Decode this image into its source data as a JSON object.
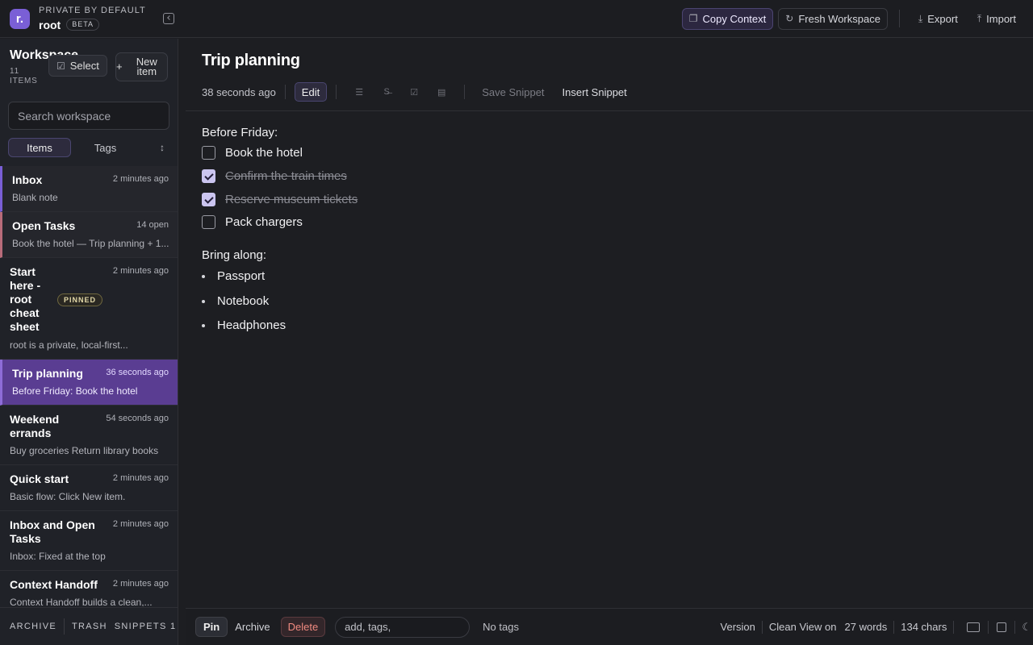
{
  "brand": {
    "tagline": "PRIVATE BY DEFAULT",
    "name": "root",
    "badge": "BETA",
    "logo_letter": "r."
  },
  "toolbar": {
    "copy_context": "Copy Context",
    "fresh_workspace": "Fresh Workspace",
    "export": "Export",
    "import": "Import"
  },
  "sidebar": {
    "title": "Workspace",
    "count": "11 ITEMS",
    "select_label": "Select",
    "new_item_label": "New item",
    "search_placeholder": "Search workspace",
    "tabs": [
      "Items",
      "Tags"
    ],
    "items": [
      {
        "title": "Inbox",
        "time": "2 minutes ago",
        "snippet": "Blank note"
      },
      {
        "title": "Open Tasks",
        "time": "14 open",
        "snippet": "Book the hotel — Trip planning + 1..."
      },
      {
        "title": "Start here - root cheat sheet",
        "time": "2 minutes ago",
        "badge": "PINNED",
        "snippet": "root is a private, local-first..."
      },
      {
        "title": "Trip planning",
        "time": "36 seconds ago",
        "snippet": "Before Friday: Book the hotel"
      },
      {
        "title": "Weekend errands",
        "time": "54 seconds ago",
        "snippet": "Buy groceries Return library books"
      },
      {
        "title": "Quick start",
        "time": "2 minutes ago",
        "snippet": "Basic flow: Click New item."
      },
      {
        "title": "Inbox and Open Tasks",
        "time": "2 minutes ago",
        "snippet": "Inbox: Fixed at the top"
      },
      {
        "title": "Context Handoff",
        "time": "2 minutes ago",
        "snippet": "Context Handoff builds a clean,..."
      }
    ],
    "footer": {
      "archive": "ARCHIVE",
      "trash": "TRASH",
      "snippets": "SNIPPETS 1"
    }
  },
  "doc": {
    "title": "Trip planning",
    "edited": "38 seconds ago",
    "edit_label": "Edit",
    "save_snippet": "Save Snippet",
    "insert_snippet": "Insert Snippet",
    "heading1": "Before Friday:",
    "tasks": [
      {
        "label": "Book the hotel",
        "done": false
      },
      {
        "label": "Confirm the train times",
        "done": true
      },
      {
        "label": "Reserve museum tickets",
        "done": true
      },
      {
        "label": "Pack chargers",
        "done": false
      }
    ],
    "heading2": "Bring along:",
    "bullets": [
      "Passport",
      "Notebook",
      "Headphones"
    ]
  },
  "footer": {
    "pin": "Pin",
    "archive": "Archive",
    "delete": "Delete",
    "tags_placeholder": "add, tags,",
    "no_tags": "No tags",
    "version": "Version",
    "clean_view": "Clean View on",
    "words": "27 words",
    "chars": "134 chars"
  },
  "colors": {
    "accent": "#7a5fd6",
    "selected_item": "#5a3d92",
    "delete": "#f08a80"
  }
}
